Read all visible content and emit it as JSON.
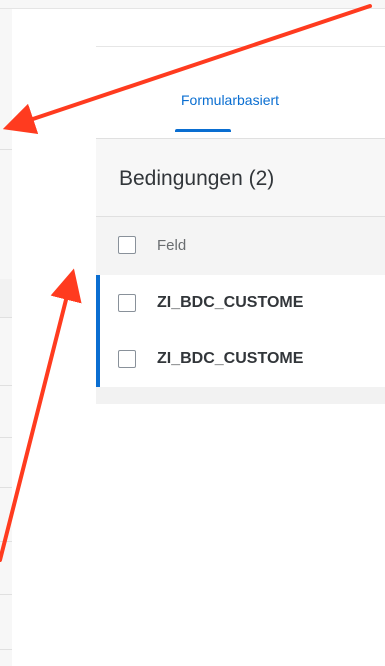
{
  "tabs": [
    {
      "label": "Formularbasiert",
      "active": true
    }
  ],
  "table": {
    "title": "Bedingungen (2)",
    "columns": [
      "Feld"
    ],
    "rows": [
      {
        "feld": "ZI_BDC_CUSTOME"
      },
      {
        "feld": "ZI_BDC_CUSTOME"
      }
    ]
  },
  "colors": {
    "accent": "#0a6ed1",
    "annotation_arrow": "#ff3b1f"
  },
  "annotations": {
    "arrow_count": 2
  }
}
